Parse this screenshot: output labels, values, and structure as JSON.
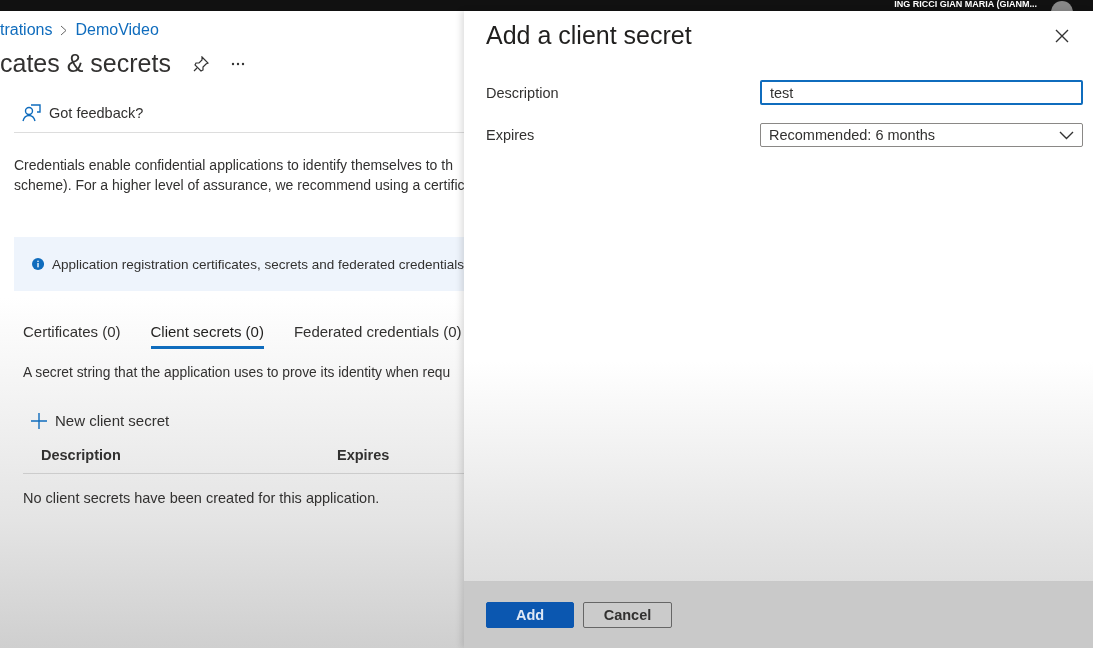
{
  "top_bar": {
    "user": "ING RICCI GIAN MARIA (GIANM..."
  },
  "breadcrumb": [
    {
      "label": "trations"
    },
    {
      "label": "DemoVideo"
    }
  ],
  "page_title": "cates & secrets",
  "feedback": "Got feedback?",
  "intro": [
    "Credentials enable confidential applications to identify themselves to th",
    "scheme). For a higher level of assurance, we recommend using a certific"
  ],
  "info_banner": "Application registration certificates, secrets and federated credentials",
  "tabs": [
    {
      "label": "Certificates (0)",
      "selected": false
    },
    {
      "label": "Client secrets (0)",
      "selected": true
    },
    {
      "label": "Federated credentials (0)",
      "selected": false
    }
  ],
  "tab_description": "A secret string that the application uses to prove its identity when requ",
  "new_button": "New client secret",
  "table": {
    "columns": [
      "Description",
      "Expires"
    ],
    "empty_message": "No client secrets have been created for this application."
  },
  "panel": {
    "title": "Add a client secret",
    "fields": [
      {
        "kind": "text",
        "label": "Description",
        "value": "test",
        "focused": true
      },
      {
        "kind": "dropdown",
        "label": "Expires",
        "value": "Recommended: 6 months",
        "focused": false
      }
    ],
    "buttons": [
      {
        "label": "Add",
        "primary": true
      },
      {
        "label": "Cancel",
        "primary": false
      }
    ]
  }
}
